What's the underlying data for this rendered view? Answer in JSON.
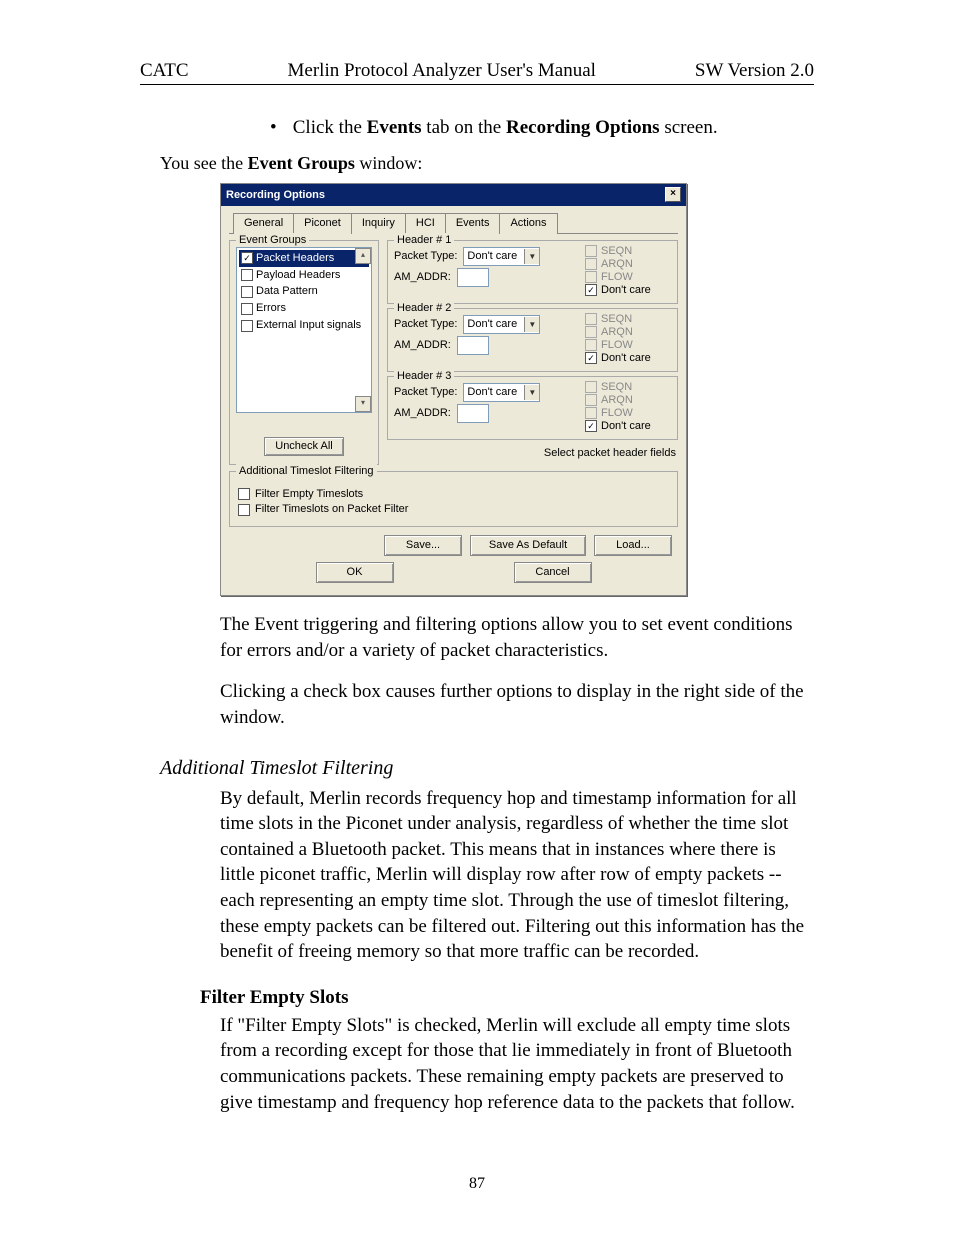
{
  "header": {
    "left": "CATC",
    "center": "Merlin Protocol Analyzer User's Manual",
    "right": "SW Version 2.0"
  },
  "page_number": "87",
  "body": {
    "bullet": {
      "pre": "Click the ",
      "b1": "Events",
      "mid": " tab on the ",
      "b2": "Recording Options",
      "post": " screen."
    },
    "intro_pre": "You see the ",
    "intro_b": "Event Groups",
    "intro_post": " window:",
    "p1": "The Event triggering and filtering options allow you to set event conditions for errors and/or a variety of packet characteristics.",
    "p2": "Clicking a check box causes further options to display in the right side of the window.",
    "sec_atf": "Additional Timeslot Filtering",
    "p3": "By default, Merlin records frequency hop and timestamp information for all time slots in the Piconet under analysis, regardless of whether the time slot contained a Bluetooth packet.  This means that in instances where there is little piconet traffic, Merlin will display row after row of empty packets -- each representing an empty time slot.  Through the use of timeslot filtering, these empty packets can be filtered out.  Filtering out this information has the benefit of freeing memory so that more traffic can be recorded.",
    "sec_fes": "Filter Empty Slots",
    "p4": "If  \"Filter Empty Slots\" is checked, Merlin will exclude all empty time slots from a recording except for those that lie immediately in front of  Bluetooth communications packets. These remaining empty packets are preserved to give timestamp and frequency hop reference data to the packets that follow."
  },
  "dialog": {
    "title": "Recording Options",
    "tabs": [
      "General",
      "Piconet",
      "Inquiry",
      "HCI",
      "Events",
      "Actions"
    ],
    "active_tab": "Events",
    "event_groups_label": "Event Groups",
    "event_groups": [
      "Packet Headers",
      "Payload Headers",
      "Data Pattern",
      "Errors",
      "External Input signals"
    ],
    "selected_group": "Packet Headers",
    "uncheck_all": "Uncheck All",
    "headers": [
      {
        "legend": "Header # 1",
        "packet_type_label": "Packet Type:",
        "packet_type_value": "Don't care",
        "am_addr_label": "AM_ADDR:"
      },
      {
        "legend": "Header # 2",
        "packet_type_label": "Packet Type:",
        "packet_type_value": "Don't care",
        "am_addr_label": "AM_ADDR:"
      },
      {
        "legend": "Header # 3",
        "packet_type_label": "Packet Type:",
        "packet_type_value": "Don't care",
        "am_addr_label": "AM_ADDR:"
      }
    ],
    "flags": {
      "seqn": "SEQN",
      "arqn": "ARQN",
      "flow": "FLOW",
      "dontcare": "Don't care"
    },
    "select_header_fields": "Select packet header fields",
    "atf": {
      "legend": "Additional Timeslot Filtering",
      "filter_empty": "Filter Empty Timeslots",
      "filter_pf": "Filter Timeslots on Packet Filter"
    },
    "buttons": {
      "save": "Save...",
      "save_default": "Save As Default",
      "load": "Load...",
      "ok": "OK",
      "cancel": "Cancel"
    }
  }
}
